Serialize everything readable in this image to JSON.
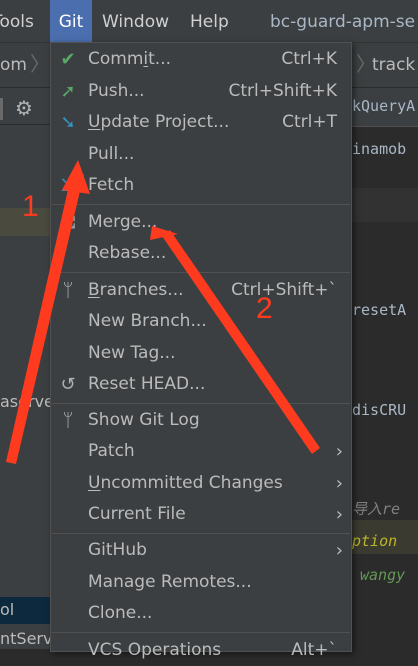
{
  "menubar": {
    "items": [
      "Tools",
      "Git",
      "Window",
      "Help"
    ],
    "window_title": "bc-guard-apm-se"
  },
  "nav": {
    "crumb_left": "om",
    "crumb_right": "track"
  },
  "left_panel": {
    "serve_text": "aserve",
    "ol_text": "ol",
    "ntserv_text": "ntServ"
  },
  "editor": {
    "tab_text": "kQueryA",
    "lines": [
      "inamob",
      "resetA",
      "disCRU",
      "导入re",
      "ption",
      "wangy"
    ]
  },
  "menu": {
    "commit": {
      "label_pre": "Comm",
      "label_u": "i",
      "label_post": "t...",
      "shortcut": "Ctrl+K"
    },
    "push": {
      "label": "Push...",
      "shortcut": "Ctrl+Shift+K"
    },
    "update": {
      "label_u": "U",
      "label_post": "pdate Project...",
      "shortcut": "Ctrl+T"
    },
    "pull": "Pull...",
    "fetch": "Fetch",
    "merge": "Merge...",
    "rebase": "Rebase...",
    "branches": {
      "label_u": "B",
      "label_post": "ranches...",
      "shortcut": "Ctrl+Shift+`"
    },
    "new_branch": "New Branch...",
    "new_tag": "New Tag...",
    "reset_head": "Reset HEAD...",
    "show_git_log": "Show Git Log",
    "patch": "Patch",
    "uncommitted": {
      "label_u": "U",
      "label_post": "ncommitted Changes"
    },
    "current_file": "Current File",
    "github": "GitHub",
    "manage_remotes": "Manage Remotes...",
    "clone": "Clone...",
    "vcs_operations": {
      "label": "VCS Operations",
      "shortcut": "Alt+`"
    }
  },
  "annotations": {
    "label1": "1",
    "label2": "2",
    "color": "#ff3b1f"
  }
}
